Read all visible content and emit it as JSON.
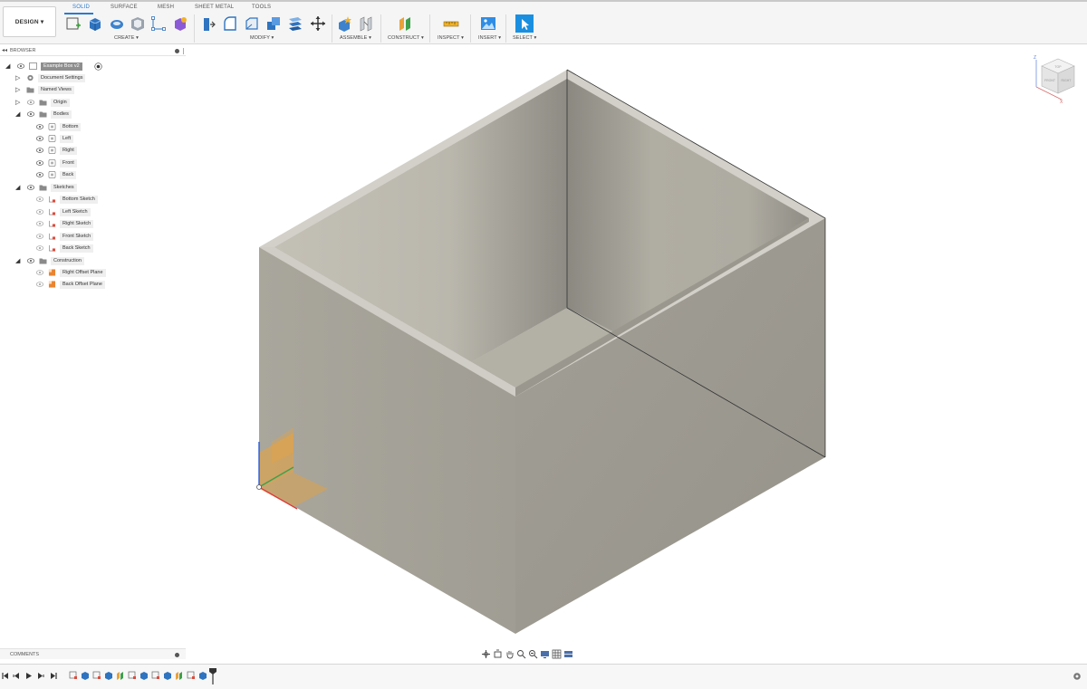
{
  "app": {
    "workspace_button": "DESIGN ▾"
  },
  "toolbar": {
    "tabs": [
      "SOLID",
      "SURFACE",
      "MESH",
      "SHEET METAL",
      "TOOLS"
    ],
    "active_tab": "SOLID",
    "groups": [
      "CREATE ▾",
      "MODIFY ▾",
      "ASSEMBLE ▾",
      "CONSTRUCT ▾",
      "INSPECT ▾",
      "INSERT ▾",
      "SELECT ▾"
    ]
  },
  "browser": {
    "title": "BROWSER",
    "tree": [
      {
        "label": "Example Box v2",
        "selected": true
      },
      {
        "label": "Document Settings"
      },
      {
        "label": "Named Views"
      },
      {
        "label": "Origin"
      },
      {
        "label": "Bodies"
      },
      {
        "label": "Bottom"
      },
      {
        "label": "Left"
      },
      {
        "label": "Right"
      },
      {
        "label": "Front"
      },
      {
        "label": "Back"
      },
      {
        "label": "Sketches"
      },
      {
        "label": "Bottom Sketch"
      },
      {
        "label": "Left Sketch"
      },
      {
        "label": "Right Sketch"
      },
      {
        "label": "Front Sketch"
      },
      {
        "label": "Back Sketch"
      },
      {
        "label": "Construction"
      },
      {
        "label": "Right Offset Plane"
      },
      {
        "label": "Back Offset Plane"
      }
    ]
  },
  "comments": {
    "title": "COMMENTS"
  },
  "viewcube": {
    "faces": [
      "TOP",
      "FRONT",
      "RIGHT"
    ],
    "axes": [
      "Z",
      "X"
    ]
  },
  "colors": {
    "accent": "#2a7ad0",
    "body": "#a7a49a"
  }
}
